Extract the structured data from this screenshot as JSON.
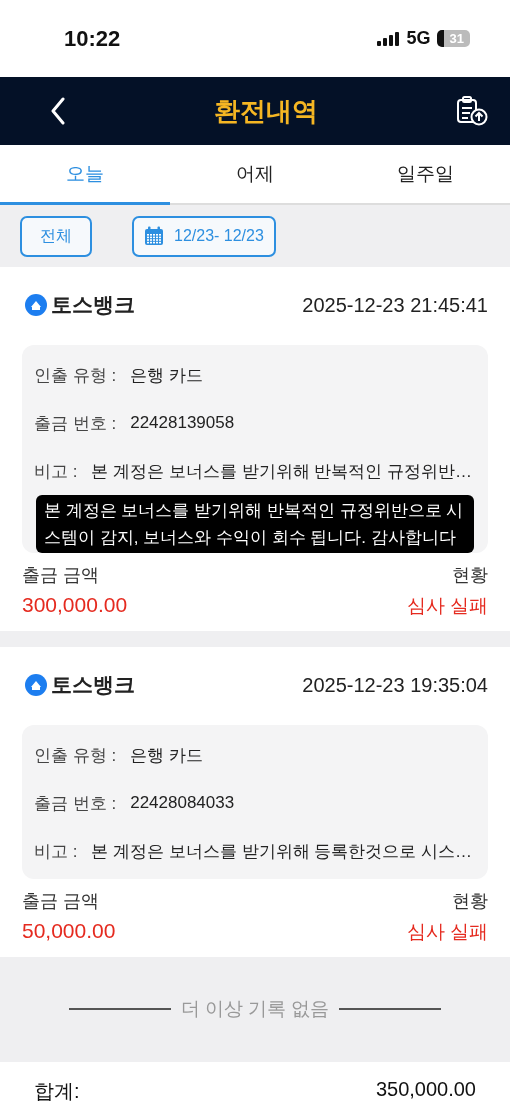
{
  "status_bar": {
    "time": "10:22",
    "network": "5G",
    "battery": "31"
  },
  "header": {
    "title": "환전내역"
  },
  "tabs": [
    {
      "label": "오늘",
      "selected": true
    },
    {
      "label": "어제",
      "selected": false
    },
    {
      "label": "일주일",
      "selected": false
    }
  ],
  "filters": {
    "all_button": "전체",
    "date_range": "12/23- 12/23"
  },
  "records": [
    {
      "bank": "토스뱅크",
      "datetime": "2025-12-23 21:45:41",
      "details": [
        {
          "label": "인출 유형 :",
          "value": "은행 카드"
        },
        {
          "label": "출금 번호 :",
          "value": "22428139058"
        },
        {
          "label": "비고 :",
          "value": "본 계정은 보너스를 받기위해 반복적인 규정위반…"
        }
      ],
      "tooltip": "본 계정은 보너스를 받기위해 반복적인 규정위반으로 시스템이 감지, 보너스와 수익이 회수 됩니다. 감사합니다",
      "amount_label": "출금 금액",
      "amount": "300,000.00",
      "status_label": "현황",
      "status": "심사 실패"
    },
    {
      "bank": "토스뱅크",
      "datetime": "2025-12-23 19:35:04",
      "details": [
        {
          "label": "인출 유형 :",
          "value": "은행 카드"
        },
        {
          "label": "출금 번호 :",
          "value": "22428084033"
        },
        {
          "label": "비고 :",
          "value": "본 계정은 보너스를 받기위해 등록한것으로 시스…"
        }
      ],
      "amount_label": "출금 금액",
      "amount": "50,000.00",
      "status_label": "현황",
      "status": "심사 실패"
    }
  ],
  "end_message": "더 이상 기록 없음",
  "total": {
    "label": "합계:",
    "value": "350,000.00"
  }
}
